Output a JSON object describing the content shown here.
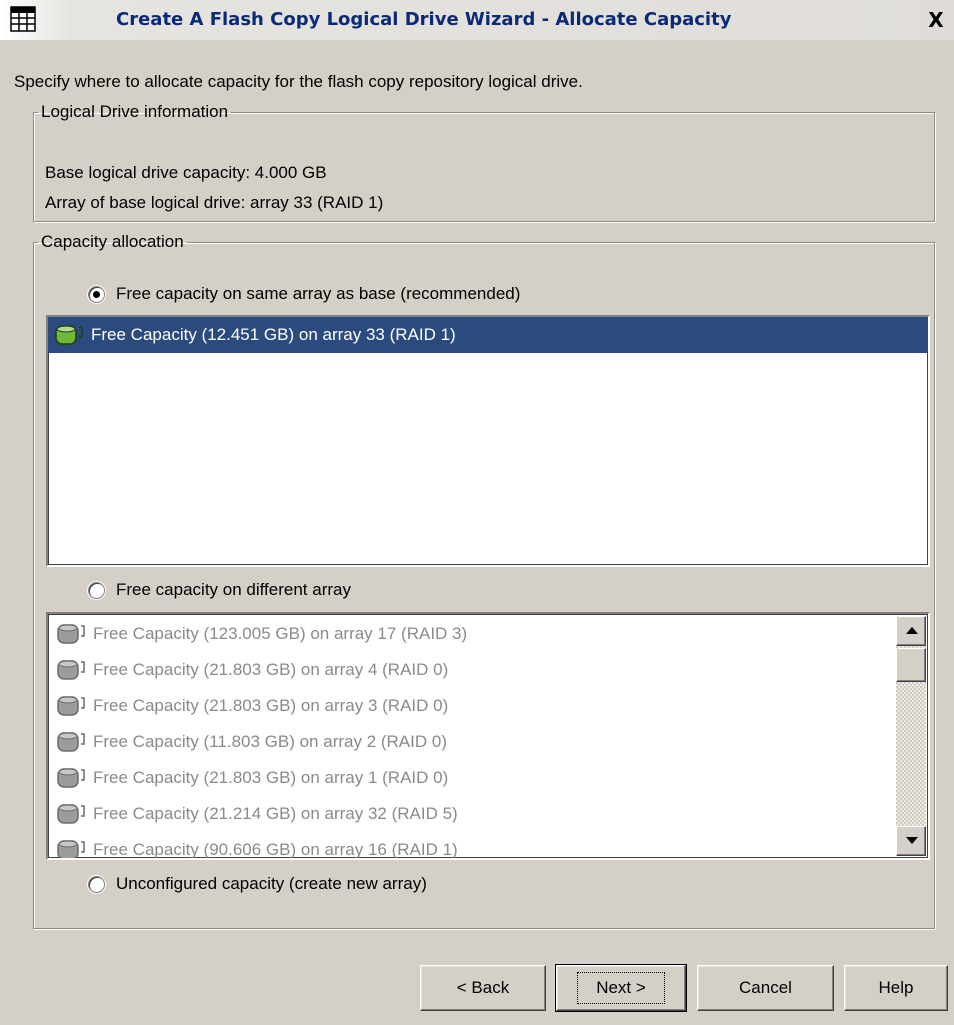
{
  "window": {
    "title": "Create A Flash Copy Logical Drive Wizard - Allocate Capacity",
    "close_label": "X"
  },
  "instructions": "Specify where to allocate capacity for the flash copy repository logical drive.",
  "logical_drive_info": {
    "legend": "Logical Drive information",
    "base_capacity": "Base logical drive capacity: 4.000 GB",
    "base_array": "Array of base logical drive: array 33 (RAID 1)"
  },
  "capacity_allocation": {
    "legend": "Capacity allocation",
    "option_same_array": "Free capacity on same array as base (recommended)",
    "option_different_array": "Free capacity on different array",
    "option_unconfigured": "Unconfigured capacity (create new array)",
    "selected_option": "same_array",
    "same_array_items": [
      "Free Capacity (12.451 GB) on array 33 (RAID 1)"
    ],
    "different_array_items": [
      "Free Capacity (123.005 GB) on array 17 (RAID 3)",
      "Free Capacity (21.803 GB) on array 4 (RAID 0)",
      "Free Capacity (21.803 GB) on array 3 (RAID 0)",
      "Free Capacity (11.803 GB) on array 2 (RAID 0)",
      "Free Capacity (21.803 GB) on array 1 (RAID 0)",
      "Free Capacity (21.214 GB) on array 32 (RAID 5)",
      "Free Capacity (90.606 GB) on array 16 (RAID 1)"
    ]
  },
  "buttons": {
    "back": "< Back",
    "next": "Next >",
    "cancel": "Cancel",
    "help": "Help"
  },
  "colors": {
    "selection": "#2b4b7e",
    "drive_icon_active": "#6fb83a",
    "drive_icon_disabled": "#9c9c9c"
  }
}
